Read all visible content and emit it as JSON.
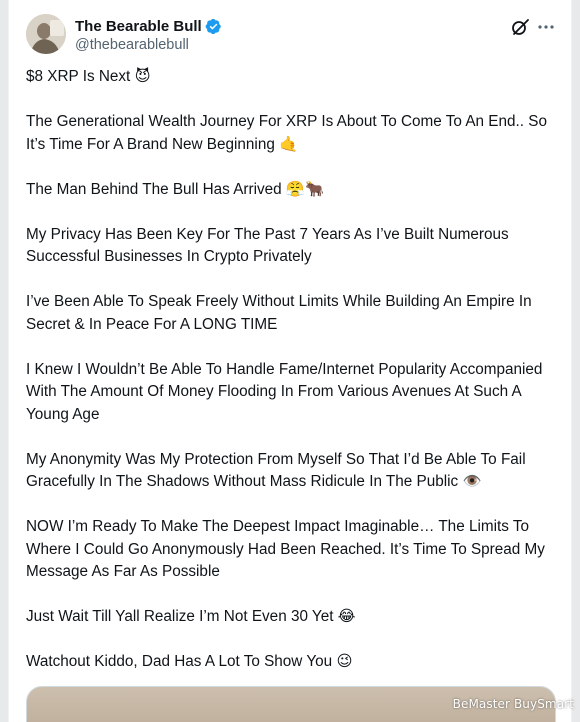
{
  "author": {
    "display_name": "The Bearable Bull",
    "handle": "@thebearablebull",
    "verified_icon": "verified-badge-icon",
    "avatar_icon": "profile-avatar"
  },
  "actions": {
    "grok_icon": "grok-slash-icon",
    "more_icon": "ellipsis-icon"
  },
  "colors": {
    "verified": "#1d9bf0",
    "text": "#0f1419",
    "muted": "#536471"
  },
  "post": {
    "paragraphs": [
      "$8 XRP Is Next 😈",
      "The Generational Wealth Journey For XRP Is About To Come To An End.. So It’s Time For A Brand New Beginning 🤙",
      "The Man Behind The Bull Has Arrived 😤🐂",
      "My Privacy Has Been Key For The Past 7 Years As I’ve Built Numerous Successful Businesses In Crypto Privately",
      "I’ve Been Able To Speak Freely Without Limits While Building An Empire In Secret & In Peace For A LONG TIME",
      "I Knew I Wouldn’t Be Able To Handle Fame/Internet Popularity Accompanied With The Amount Of Money Flooding In From Various Avenues At Such A Young Age",
      "My Anonymity Was My Protection From Myself So That I’d Be Able To Fail Gracefully In The Shadows Without Mass Ridicule In The Public 👁️",
      "NOW I’m Ready To Make The Deepest Impact Imaginable… The Limits To Where I Could Go Anonymously Had Been Reached. It’s Time To Spread My Message As Far As Possible",
      "Just Wait Till Yall Realize I’m Not Even 30 Yet 😂",
      "Watchout Kiddo, Dad Has A Lot To Show You 😉"
    ]
  },
  "watermark": "BeMaster BuySmart"
}
